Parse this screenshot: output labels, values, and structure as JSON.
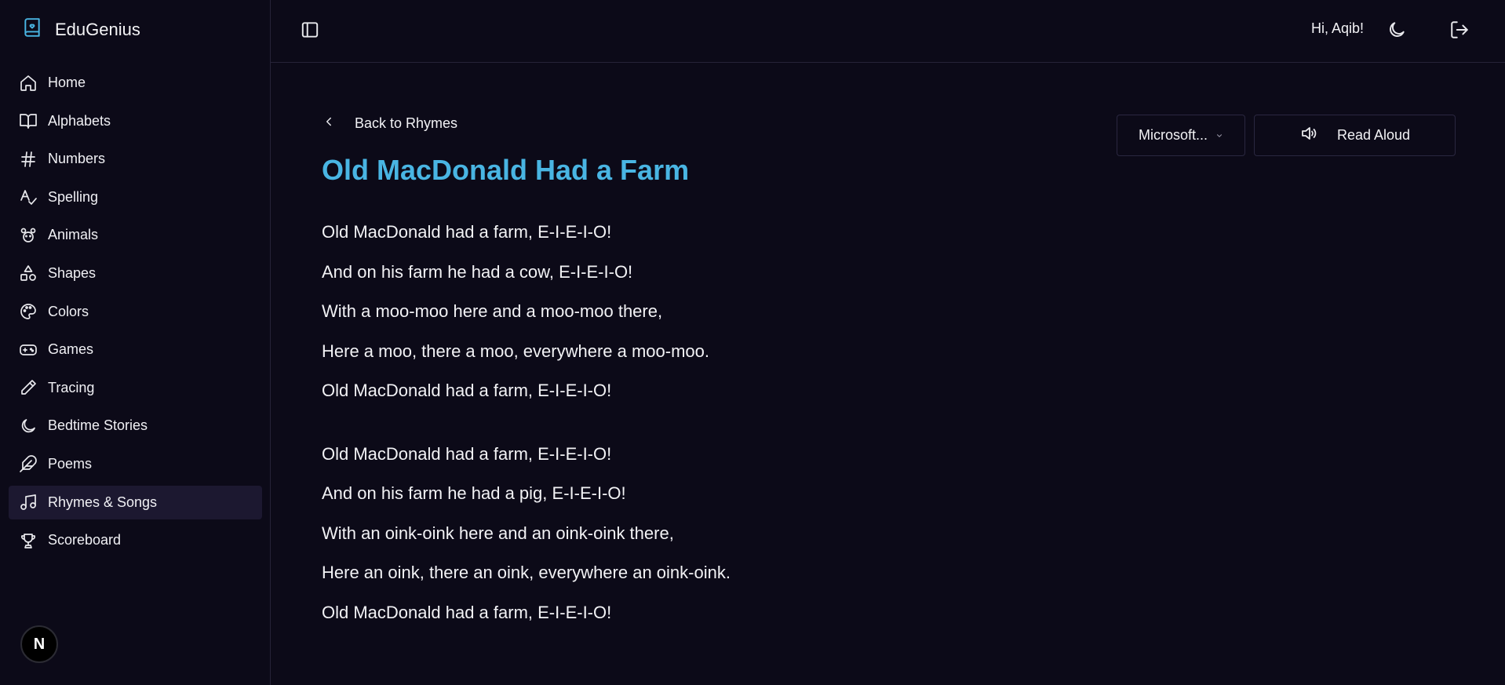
{
  "brand": {
    "title": "EduGenius"
  },
  "nav": {
    "items": [
      {
        "label": "Home",
        "icon": "home-icon"
      },
      {
        "label": "Alphabets",
        "icon": "book-open-icon"
      },
      {
        "label": "Numbers",
        "icon": "hash-icon"
      },
      {
        "label": "Spelling",
        "icon": "spell-check-icon"
      },
      {
        "label": "Animals",
        "icon": "paw-icon"
      },
      {
        "label": "Shapes",
        "icon": "shapes-icon"
      },
      {
        "label": "Colors",
        "icon": "palette-icon"
      },
      {
        "label": "Games",
        "icon": "gamepad-icon"
      },
      {
        "label": "Tracing",
        "icon": "pencil-icon"
      },
      {
        "label": "Bedtime Stories",
        "icon": "moon-icon"
      },
      {
        "label": "Poems",
        "icon": "feather-icon"
      },
      {
        "label": "Rhymes & Songs",
        "icon": "music-icon",
        "active": true
      },
      {
        "label": "Scoreboard",
        "icon": "trophy-icon"
      }
    ]
  },
  "badge": {
    "letter": "N"
  },
  "header": {
    "greeting": "Hi, Aqib!"
  },
  "main": {
    "back_label": "Back to Rhymes",
    "title": "Old MacDonald Had a Farm",
    "voice_select": "Microsoft...",
    "read_aloud": "Read Aloud",
    "stanzas": [
      [
        "Old MacDonald had a farm, E-I-E-I-O!",
        "And on his farm he had a cow, E-I-E-I-O!",
        "With a moo-moo here and a moo-moo there,",
        "Here a moo, there a moo, everywhere a moo-moo.",
        "Old MacDonald had a farm, E-I-E-I-O!"
      ],
      [
        "Old MacDonald had a farm, E-I-E-I-O!",
        "And on his farm he had a pig, E-I-E-I-O!",
        "With an oink-oink here and an oink-oink there,",
        "Here an oink, there an oink, everywhere an oink-oink.",
        "Old MacDonald had a farm, E-I-E-I-O!"
      ]
    ]
  },
  "colors": {
    "background": "#0c0a18",
    "accent": "#49b5e3",
    "active_nav": "#1c1830",
    "border": "#262338"
  }
}
